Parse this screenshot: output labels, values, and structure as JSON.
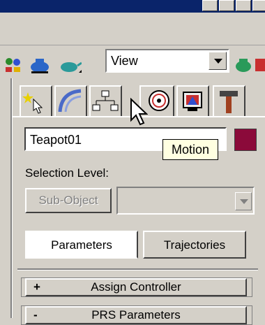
{
  "toolbar": {
    "view_dropdown": "View"
  },
  "object": {
    "name": "Teapot01",
    "color": "#8b0a3a"
  },
  "tooltip": {
    "text": "Motion"
  },
  "selection": {
    "label": "Selection Level:",
    "subobject_button": "Sub-Object"
  },
  "motion_tabs": [
    {
      "label": "Parameters"
    },
    {
      "label": "Trajectories"
    }
  ],
  "rollouts": [
    {
      "sign": "+",
      "title": "Assign Controller"
    },
    {
      "sign": "-",
      "title": "PRS Parameters"
    }
  ],
  "icons": [
    "create-icon",
    "modify-icon",
    "hierarchy-icon",
    "motion-icon",
    "display-icon",
    "utilities-icon"
  ]
}
